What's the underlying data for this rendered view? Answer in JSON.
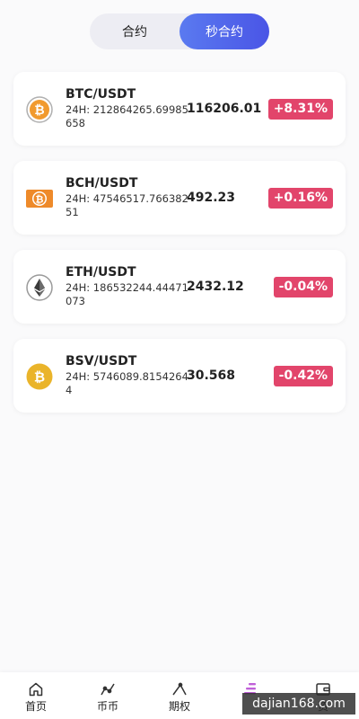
{
  "tabs": [
    {
      "label": "合约",
      "active": false
    },
    {
      "label": "秒合约",
      "active": true
    }
  ],
  "markets": [
    {
      "pair": "BTC/USDT",
      "volume": "24H: 212864265.69985658",
      "price": "116206.01",
      "change": "+8.31%",
      "icon": "bitcoin-icon"
    },
    {
      "pair": "BCH/USDT",
      "volume": "24H: 47546517.76638251",
      "price": "492.23",
      "change": "+0.16%",
      "icon": "bitcoin-cash-icon"
    },
    {
      "pair": "ETH/USDT",
      "volume": "24H: 186532244.44471073",
      "price": "2432.12",
      "change": "-0.04%",
      "icon": "ethereum-icon"
    },
    {
      "pair": "BSV/USDT",
      "volume": "24H: 5746089.81542644",
      "price": "30.568",
      "change": "-0.42%",
      "icon": "bitcoin-sv-icon"
    }
  ],
  "nav": [
    {
      "label": "首页",
      "icon": "home-icon"
    },
    {
      "label": "币币",
      "icon": "trade-icon"
    },
    {
      "label": "期权",
      "icon": "options-icon"
    },
    {
      "label": "",
      "icon": "contract-icon"
    },
    {
      "label": "资",
      "icon": "wallet-icon"
    }
  ],
  "watermark": "dajian168.com",
  "colors": {
    "accent": "#4a55e6",
    "badge": "#e2456b"
  }
}
